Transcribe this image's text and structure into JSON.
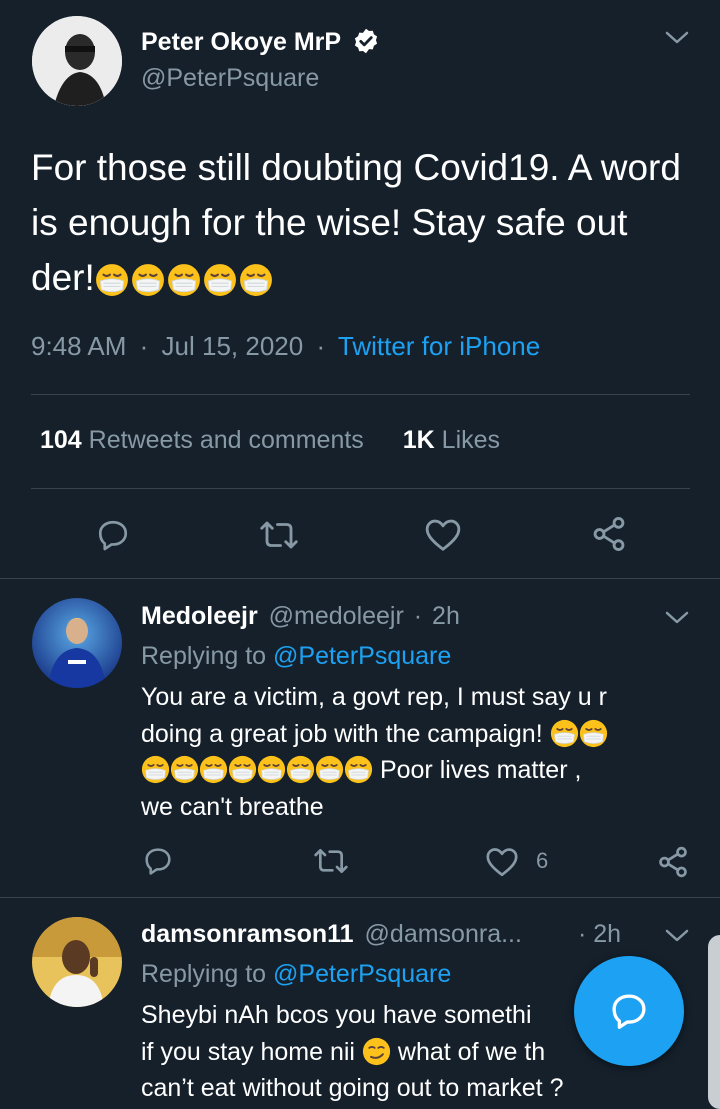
{
  "main_tweet": {
    "author_name": "Peter Okoye MrP",
    "verified": true,
    "handle": "@PeterPsquare",
    "text": "For those still doubting Covid19. A word is enough for the wise! Stay safe out der!",
    "emoji_count": 5,
    "time": "9:48 AM",
    "separator": "·",
    "date": "Jul 15, 2020",
    "source": "Twitter for iPhone",
    "retweets_count": "104",
    "retweets_label": "Retweets and comments",
    "likes_count": "1K",
    "likes_label": "Likes"
  },
  "replies": [
    {
      "author_name": "Medoleejr",
      "handle": "@medoleejr",
      "separator": "·",
      "time": "2h",
      "replying_prefix": "Replying to",
      "replying_to": "@PeterPsquare",
      "text_line1": "You are a victim, a govt rep, I must say u r",
      "text_line2": "doing a great job with the campaign!",
      "text_line3_suffix": "Poor lives matter ,",
      "text_line4": "we can't breathe",
      "like_count": "6"
    },
    {
      "author_name": "damsonramson11",
      "handle": "@damsonra...",
      "separator": "·",
      "time": "2h",
      "replying_prefix": "Replying to",
      "replying_to": "@PeterPsquare",
      "text_line1": "Sheybi nAh bcos you have somethi",
      "text_line2_a": "if you stay home nii",
      "text_line2_b": "what of we th",
      "text_line3": "can’t eat without going out to market ?"
    }
  ],
  "colors": {
    "background": "#15202b",
    "accent": "#1da1f2",
    "muted": "#8899a6",
    "divider": "#38444d"
  }
}
